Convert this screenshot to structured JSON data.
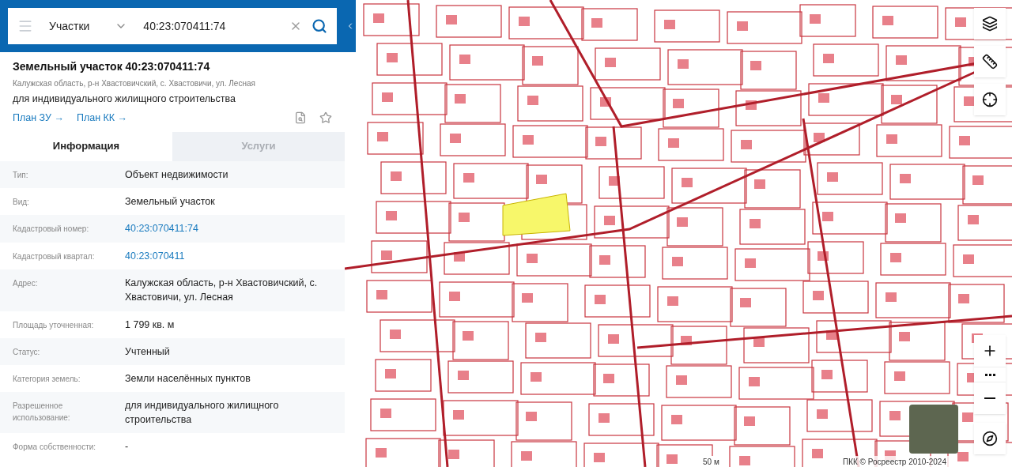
{
  "search": {
    "category": "Участки",
    "value": "40:23:070411:74"
  },
  "parcel": {
    "title": "Земельный участок 40:23:070411:74",
    "address": "Калужская область, р-н Хвастовичский, с. Хвастовичи, ул. Лесная",
    "purpose": "для индивидуального жилищного строительства",
    "links": [
      "План ЗУ →",
      "План КК →"
    ]
  },
  "tabs": [
    {
      "label": "Информация",
      "selected": true
    },
    {
      "label": "Услуги",
      "selected": false
    }
  ],
  "info_rows": [
    {
      "label": "Тип:",
      "value": "Объект недвижимости",
      "kind": "text"
    },
    {
      "label": "Вид:",
      "value": "Земельный участок",
      "kind": "text"
    },
    {
      "label": "Кадастровый номер:",
      "value": "40:23:070411:74",
      "kind": "link"
    },
    {
      "label": "Кадастровый квартал:",
      "value": "40:23:070411",
      "kind": "link"
    },
    {
      "label": "Адрес:",
      "value": "Калужская область, р-н Хвастовичский, с. Хвастовичи, ул. Лесная",
      "kind": "text"
    },
    {
      "label": "Площадь уточненная:",
      "value": "1 799 кв. м",
      "kind": "text"
    },
    {
      "label": "Статус:",
      "value": "Учтенный",
      "kind": "text"
    },
    {
      "label": "Категория земель:",
      "value": "Земли населённых пунктов",
      "kind": "text"
    },
    {
      "label": "Разрешенное использование:",
      "value": "для индивидуального жилищного строительства",
      "kind": "text"
    },
    {
      "label": "Форма собственности:",
      "value": "-",
      "kind": "text"
    }
  ],
  "map": {
    "scale": "50 м",
    "attribution": "ПКК © Росреестр 2010-2024"
  }
}
